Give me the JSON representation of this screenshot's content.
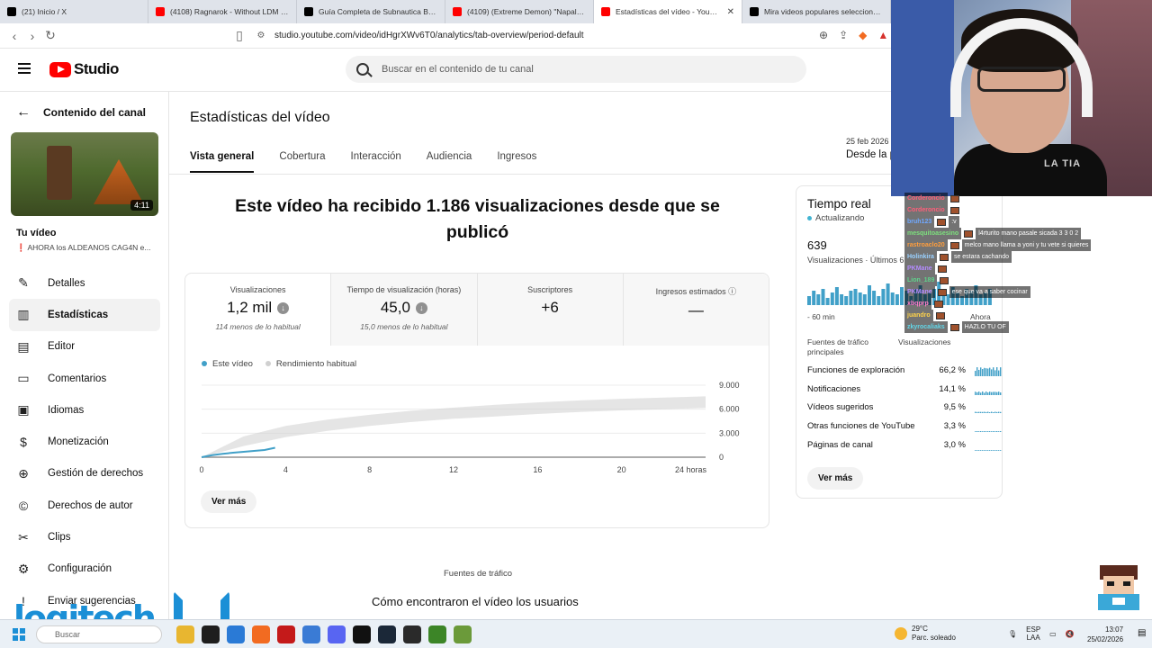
{
  "browser": {
    "tabs": [
      {
        "label": "(21) Inicio / X",
        "icon": "x-logo-icon",
        "color": "#000000"
      },
      {
        "label": "(4108) Ragnarok - Without LDM in Pe",
        "icon": "youtube-icon",
        "color": "#ff0000"
      },
      {
        "label": "Guía Completa de Subnautica Below",
        "icon": "tiktok-icon",
        "color": "#000000"
      },
      {
        "label": "(4109) (Extreme Demon) \"Napalm\" 1",
        "icon": "youtube-icon",
        "color": "#ff0000"
      },
      {
        "label": "Estadísticas del vídeo - YouTube",
        "icon": "youtube-studio-icon",
        "color": "#ff0000",
        "active": true
      },
      {
        "label": "Mira videos populares seleccionados",
        "icon": "tiktok-icon",
        "color": "#000000"
      }
    ],
    "url": "studio.youtube.com/video/idHgrXWv6T0/analytics/tab-overview/period-default"
  },
  "studio": {
    "logo_text": "Studio",
    "search_placeholder": "Buscar en el contenido de tu canal"
  },
  "sidebar": {
    "back_label": "Contenido del canal",
    "duration": "4:11",
    "your_video": "Tu vídeo",
    "video_title_mark": "❗",
    "video_title": "AHORA los ALDEANOS CAG4N e...",
    "items": [
      {
        "label": "Detalles",
        "icon": "pencil-icon",
        "glyph": "✎"
      },
      {
        "label": "Estadísticas",
        "icon": "analytics-icon",
        "glyph": "▥",
        "active": true
      },
      {
        "label": "Editor",
        "icon": "editor-icon",
        "glyph": "▤"
      },
      {
        "label": "Comentarios",
        "icon": "comment-icon",
        "glyph": "▭"
      },
      {
        "label": "Idiomas",
        "icon": "subtitles-icon",
        "glyph": "▣"
      },
      {
        "label": "Monetización",
        "icon": "dollar-icon",
        "glyph": "$"
      },
      {
        "label": "Gestión de derechos",
        "icon": "rights-icon",
        "glyph": "⊕"
      },
      {
        "label": "Derechos de autor",
        "icon": "copyright-icon",
        "glyph": "©"
      },
      {
        "label": "Clips",
        "icon": "scissors-icon",
        "glyph": "✂"
      },
      {
        "label": "Configuración",
        "icon": "gear-icon",
        "glyph": "⚙"
      },
      {
        "label": "Enviar sugerencias",
        "icon": "feedback-icon",
        "glyph": "!"
      }
    ]
  },
  "main": {
    "title": "Estadísticas del vídeo",
    "tabs": [
      "Vista general",
      "Cobertura",
      "Interacción",
      "Audiencia",
      "Ingresos"
    ],
    "date_small": "25 feb 2026",
    "date_range": "Desde la p",
    "headline": "Este vídeo ha recibido 1.186 visualizaciones desde que se publicó",
    "metrics": [
      {
        "label": "Visualizaciones",
        "value": "1,2 mil",
        "sub": "114 menos de lo habitual",
        "trend": "down"
      },
      {
        "label": "Tiempo de visualización (horas)",
        "value": "45,0",
        "sub": "15,0 menos de lo habitual",
        "trend": "down"
      },
      {
        "label": "Suscriptores",
        "value": "+6",
        "sub": ""
      },
      {
        "label": "Ingresos estimados",
        "value": "—",
        "sub": "",
        "info": true
      }
    ],
    "legend": [
      {
        "label": "Este vídeo",
        "color": "#41a0c8"
      },
      {
        "label": "Rendimiento habitual",
        "color": "#d0d0d0"
      }
    ],
    "see_more": "Ver más",
    "traffic_label": "Fuentes de tráfico",
    "traffic_title": "Cómo encontraron el vídeo los usuarios"
  },
  "chart_data": {
    "type": "line",
    "x_ticks": [
      "0",
      "4",
      "8",
      "12",
      "16",
      "20",
      "24 horas"
    ],
    "y_ticks": [
      "9.000",
      "6.000",
      "3.000",
      "0"
    ],
    "ylim": [
      0,
      9000
    ],
    "xlim": [
      0,
      24
    ],
    "grid": true,
    "series": [
      {
        "name": "Este vídeo",
        "color": "#41a0c8",
        "x": [
          0,
          0.5,
          1,
          1.5,
          2,
          2.5,
          3,
          3.5
        ],
        "y": [
          0,
          250,
          420,
          560,
          680,
          790,
          900,
          1186
        ]
      },
      {
        "name": "Rendimiento habitual",
        "color": "#cfcfcf",
        "x": [
          0,
          2,
          4,
          6,
          8,
          10,
          12,
          14,
          16,
          18,
          20,
          22,
          24
        ],
        "y_low": [
          0,
          1400,
          2500,
          3300,
          3900,
          4400,
          4800,
          5100,
          5400,
          5650,
          5850,
          6000,
          6150
        ],
        "y_high": [
          0,
          2600,
          3900,
          4700,
          5300,
          5800,
          6200,
          6550,
          6850,
          7100,
          7300,
          7450,
          7600
        ]
      }
    ]
  },
  "realtime": {
    "title": "Tiempo real",
    "status": "Actualizando",
    "status_color": "#41b4d2",
    "count": "639",
    "views_label": "Visualizaciones · Últimos 6",
    "bars": [
      5,
      8,
      6,
      9,
      4,
      7,
      10,
      6,
      5,
      8,
      9,
      7,
      6,
      11,
      8,
      5,
      9,
      12,
      7,
      6,
      10,
      8,
      5,
      9,
      11,
      6,
      7,
      9,
      13,
      8,
      6,
      10,
      7,
      5,
      9,
      8,
      11,
      6,
      7,
      9
    ],
    "min_label": "- 60 min",
    "now_label": "Ahora",
    "sources_header": "Fuentes de tráfico principales",
    "views_header": "Visualizaciones",
    "sources": [
      {
        "label": "Funciones de exploración",
        "pct": "66,2 %"
      },
      {
        "label": "Notificaciones",
        "pct": "14,1 %"
      },
      {
        "label": "Vídeos sugeridos",
        "pct": "9,5 %"
      },
      {
        "label": "Otras funciones de YouTube",
        "pct": "3,3 %"
      },
      {
        "label": "Páginas de canal",
        "pct": "3,0 %"
      }
    ],
    "see_more": "Ver más"
  },
  "webcam": {
    "shirt_text": "LA TIA"
  },
  "chat": [
    {
      "user": "Corderoncio",
      "color": "#ff5e7a",
      "msg": ""
    },
    {
      "user": "Corderoncio",
      "color": "#ff5e7a",
      "msg": ""
    },
    {
      "user": "bruh123",
      "color": "#6fa8ff",
      "msg": ":v"
    },
    {
      "user": "mesquitoasesino",
      "color": "#7de07d",
      "msg": "l4rturito mano pasale sicada 3 3 0 2"
    },
    {
      "user": "rastroaclo20",
      "color": "#ff9e3d",
      "msg": "melco mano llama a yoni y tu vete si quieres"
    },
    {
      "user": "Holinkira",
      "color": "#9ad1ff",
      "msg": "se estara cachando"
    },
    {
      "user": "PKMane",
      "color": "#b48bff",
      "msg": ""
    },
    {
      "user": "Lion_189",
      "color": "#5fd38c",
      "msg": ""
    },
    {
      "user": "PKMane",
      "color": "#b48bff",
      "msg": "ese que va a saber cocinar"
    },
    {
      "user": "xbqprp",
      "color": "#ff7ac6",
      "msg": ""
    },
    {
      "user": "juandro",
      "color": "#ffd34a",
      "msg": ""
    },
    {
      "user": "zkyrocaliaks",
      "color": "#62d6e8",
      "msg": "HAZLO TU OF"
    }
  ],
  "taskbar": {
    "search_placeholder": "Buscar",
    "weather_temp": "29°C",
    "weather_desc": "Parc. soleado",
    "lang1": "ESP",
    "lang2": "LAA",
    "time": "13:07",
    "date": "25/02/2026",
    "apps": [
      {
        "icon": "file-explorer-icon",
        "color": "#e8b630"
      },
      {
        "icon": "terminal-icon",
        "color": "#1e1e1e"
      },
      {
        "icon": "store-icon",
        "color": "#2a7ad6"
      },
      {
        "icon": "brave-icon",
        "color": "#f26b21"
      },
      {
        "icon": "media-icon",
        "color": "#c41a1a"
      },
      {
        "icon": "notepad-icon",
        "color": "#3a7bd5"
      },
      {
        "icon": "discord-icon",
        "color": "#5865f2"
      },
      {
        "icon": "capcut-icon",
        "color": "#111111"
      },
      {
        "icon": "steam-icon",
        "color": "#1b2838"
      },
      {
        "icon": "obs-icon",
        "color": "#2a2a2a"
      },
      {
        "icon": "minecraft-icon",
        "color": "#3c8527"
      },
      {
        "icon": "minecraft-block-icon",
        "color": "#6b9a3a"
      }
    ]
  },
  "overlay": {
    "logo_text": "logitech",
    "logo_color": "#1b8fd6"
  }
}
